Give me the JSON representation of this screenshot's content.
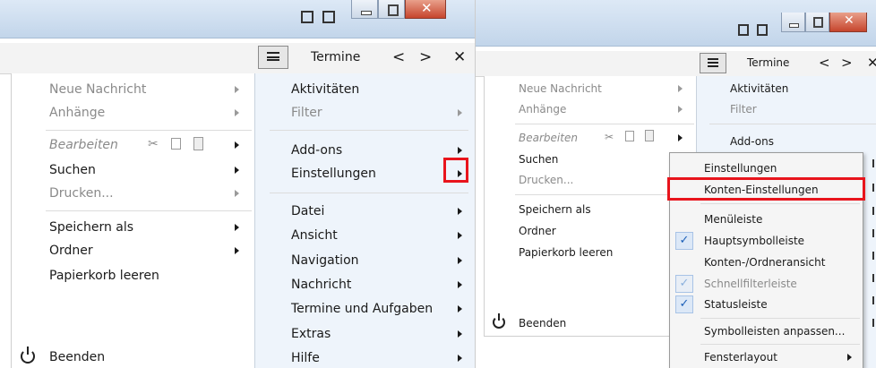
{
  "left": {
    "toolbar": {
      "calendar_title": "Termine"
    },
    "main_menu": {
      "items": [
        "Neue Nachricht",
        "Anhänge",
        "Bearbeiten",
        "Suchen",
        "Drucken...",
        "Speichern als",
        "Ordner",
        "Papierkorb leeren"
      ],
      "quit": "Beenden"
    },
    "sub_menu": {
      "items": [
        "Aktivitäten",
        "Filter",
        "Add-ons",
        "Einstellungen",
        "Datei",
        "Ansicht",
        "Navigation",
        "Nachricht",
        "Termine und Aufgaben",
        "Extras",
        "Hilfe"
      ]
    }
  },
  "right": {
    "toolbar": {
      "calendar_title": "Termine"
    },
    "main_menu": {
      "items": [
        "Neue Nachricht",
        "Anhänge",
        "Bearbeiten",
        "Suchen",
        "Drucken...",
        "Speichern als",
        "Ordner",
        "Papierkorb leeren"
      ],
      "quit": "Beenden"
    },
    "sub_menu": {
      "items": [
        "Aktivitäten",
        "Filter",
        "Add-ons"
      ]
    },
    "popup": {
      "items": [
        "Einstellungen",
        "Konten-Einstellungen",
        "Menüleiste",
        "Hauptsymbolleiste",
        "Konten-/Ordneransicht",
        "Schnellfilterleiste",
        "Statusleiste",
        "Symbolleisten anpassen...",
        "Fensterlayout"
      ]
    }
  },
  "colors": {
    "highlight": "#e8141c",
    "check": "#1c5fb8"
  }
}
